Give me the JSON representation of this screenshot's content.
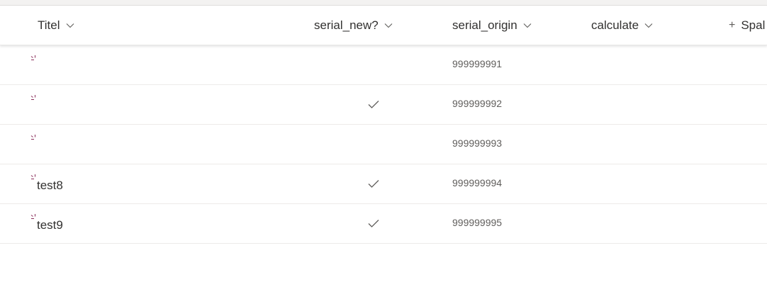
{
  "header": {
    "columns": [
      {
        "label": "Titel"
      },
      {
        "label": "serial_new?"
      },
      {
        "label": "serial_origin"
      },
      {
        "label": "calculate"
      }
    ],
    "add_column_label": "Spal"
  },
  "rows": [
    {
      "title": "",
      "serial_new": false,
      "serial_origin": "999999991"
    },
    {
      "title": "",
      "serial_new": true,
      "serial_origin": "999999992"
    },
    {
      "title": "",
      "serial_new": false,
      "serial_origin": "999999993"
    },
    {
      "title": "test8",
      "serial_new": true,
      "serial_origin": "999999994"
    },
    {
      "title": "test9",
      "serial_new": true,
      "serial_origin": "999999995"
    }
  ],
  "colors": {
    "spinner": "#8a2d5a",
    "text": "#323130",
    "muted": "#605e5c"
  },
  "icons": {
    "sort": "chevron-down-icon",
    "loading": "loading-spinner-icon",
    "check": "checkmark-icon",
    "add": "plus-icon"
  }
}
